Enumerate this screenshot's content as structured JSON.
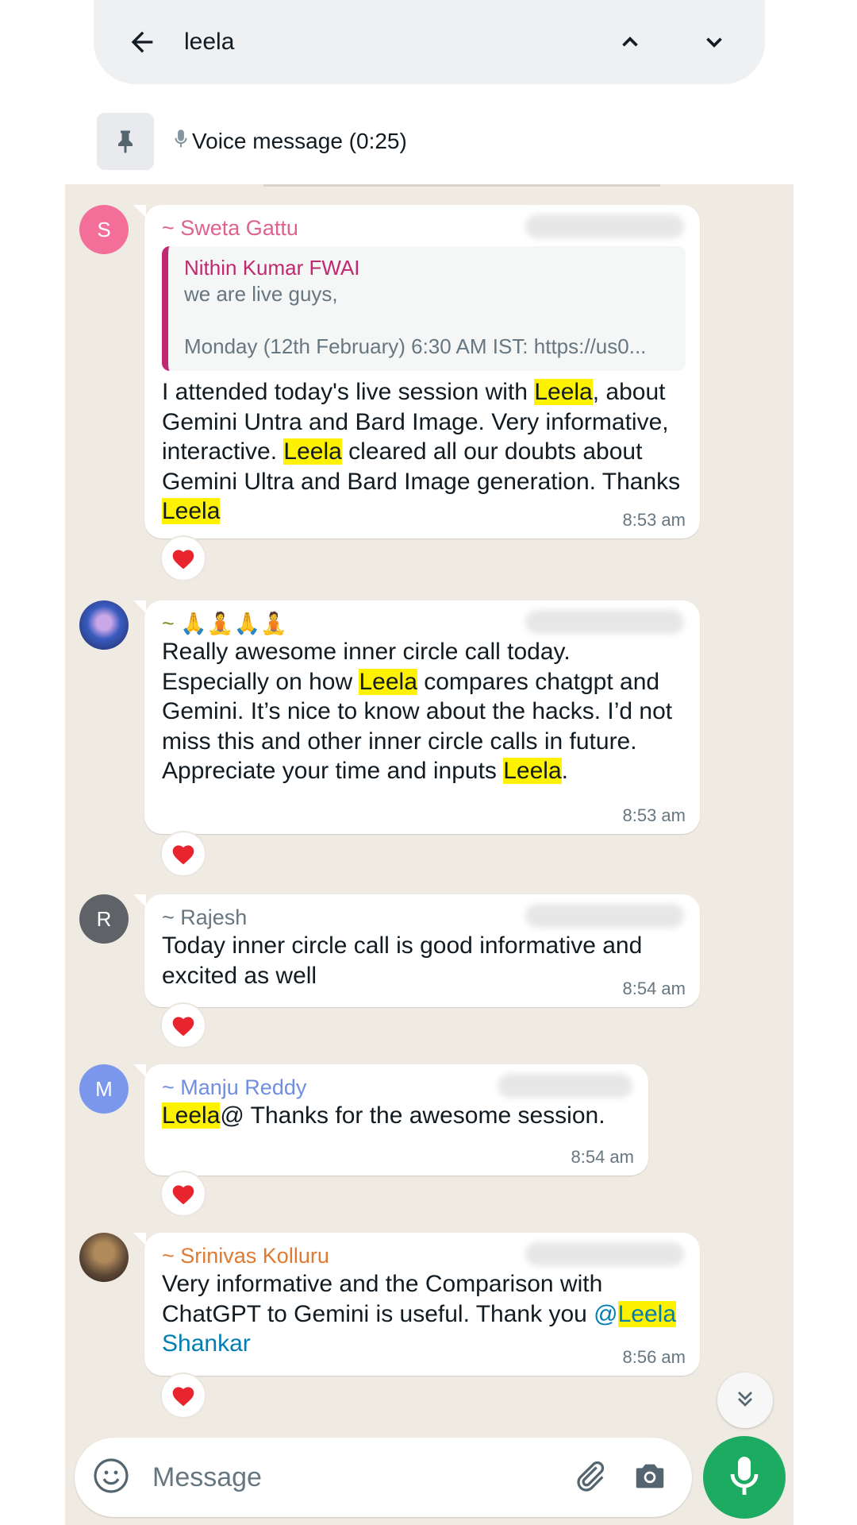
{
  "search": {
    "query": "leela"
  },
  "pinned": {
    "label": "Voice message (0:25)"
  },
  "messages": [
    {
      "avatar_letter": "S",
      "avatar_color": "#f36f9a",
      "sender": "~ Sweta Gattu",
      "sender_color": "#e0608f",
      "quote": {
        "author": "Nithin Kumar FWAI",
        "line1": "we are live guys,",
        "line2": "Monday (12th February) 6:30 AM IST: https://us0..."
      },
      "parts": [
        [
          "I attended today's live session with ",
          false
        ],
        [
          "Leela",
          true
        ],
        [
          ", about Gemini Untra and Bard Image. Very informative, interactive. ",
          false
        ],
        [
          "Leela",
          true
        ],
        [
          " cleared all our doubts about Gemini Ultra and Bard Image generation. Thanks ",
          false
        ],
        [
          "Leela",
          true
        ]
      ],
      "time": "8:53 am",
      "reaction": "heart"
    },
    {
      "avatar_letter": "",
      "avatar_color": "#6a5acd",
      "sender": "~ 🙏🧘🙏🧘",
      "sender_color": "#7c8f1f",
      "parts": [
        [
          "Really awesome inner circle call today. Especially on how ",
          false
        ],
        [
          "Leela",
          true
        ],
        [
          " compares chatgpt and Gemini. It’s nice to know about the hacks. I’d not miss this and other inner circle calls in future.\nAppreciate your time and inputs ",
          false
        ],
        [
          "Leela",
          true
        ],
        [
          ".",
          false
        ]
      ],
      "time": "8:53 am",
      "reaction": "heart"
    },
    {
      "avatar_letter": "R",
      "avatar_color": "#5f6368",
      "sender": "~ Rajesh",
      "sender_color": "#667781",
      "parts": [
        [
          "Today inner circle call is good informative and excited as well",
          false
        ]
      ],
      "time": "8:54 am",
      "reaction": "heart"
    },
    {
      "avatar_letter": "M",
      "avatar_color": "#7b97ec",
      "sender": "~ Manju Reddy",
      "sender_color": "#6f8ee0",
      "parts": [
        [
          "Leela",
          true
        ],
        [
          "@ Thanks for the awesome session.",
          false
        ]
      ],
      "time": "8:54 am",
      "reaction": "heart"
    },
    {
      "avatar_letter": "",
      "avatar_color": "#5b4636",
      "sender": "~ Srinivas Kolluru",
      "sender_color": "#e07a30",
      "parts": [
        [
          "Very informative and the Comparison with ChatGPT to Gemini is useful. Thank you ",
          false
        ],
        [
          "@",
          false,
          "link"
        ],
        [
          "Leela",
          true,
          "link"
        ],
        [
          " Shankar",
          false,
          "link"
        ]
      ],
      "time": "8:56 am",
      "reaction": "heart"
    }
  ],
  "composer": {
    "placeholder": "Message"
  },
  "colors": {
    "accent": "#1daa61",
    "highlight": "#fff200",
    "chat_bg": "#efeae2"
  }
}
